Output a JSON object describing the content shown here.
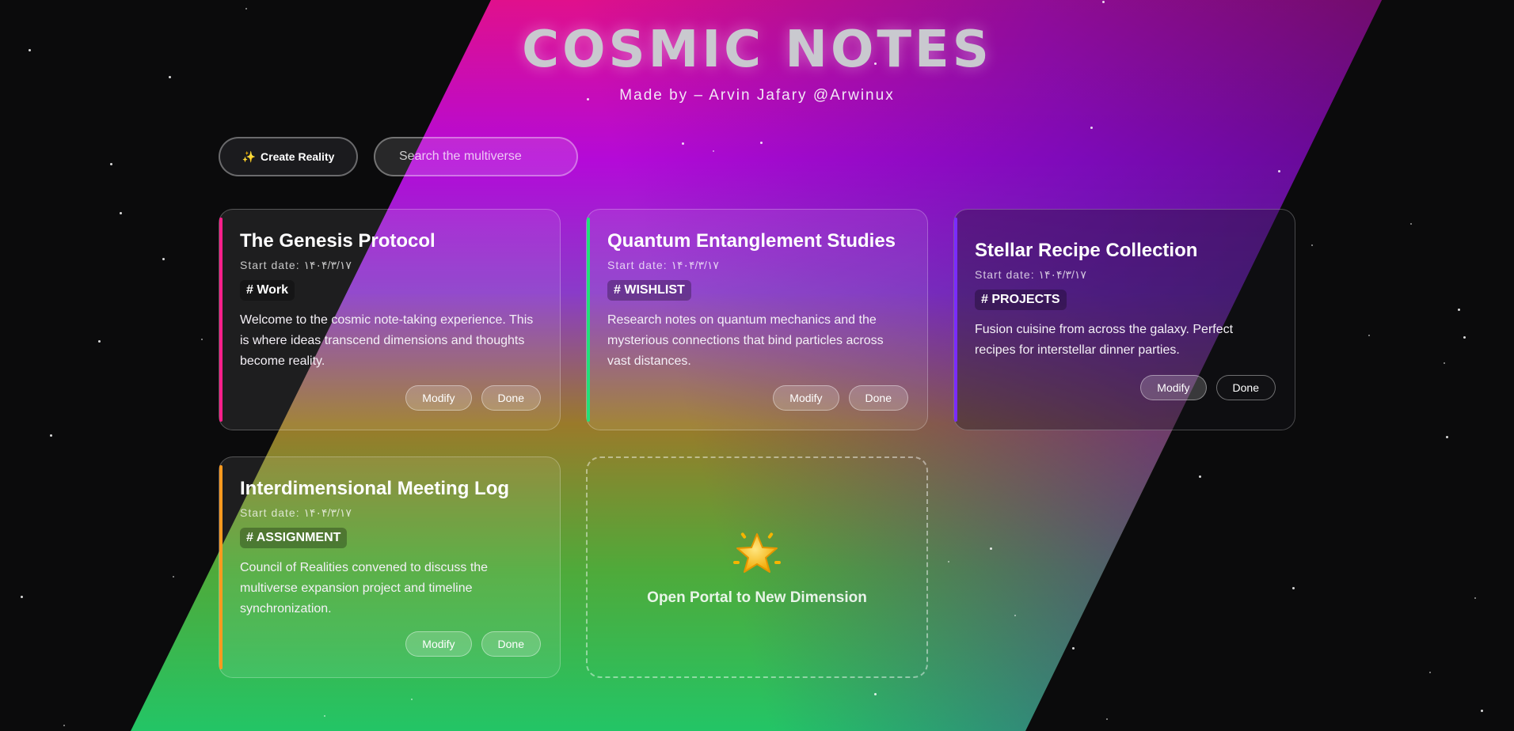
{
  "app": {
    "title": "COSMIC NOTES",
    "subtitle": "Made by – Arvin Jafary @Arwinux"
  },
  "toolbar": {
    "create_label": "Create Reality",
    "create_icon": "sparkles-icon",
    "search_placeholder": "Search the multiverse"
  },
  "notes": [
    {
      "title": "The Genesis Protocol",
      "date": "Start date: ۱۴۰۴/۳/۱۷",
      "tag": "# Work",
      "body": "Welcome to the cosmic note-taking experience. This is where ideas transcend dimensions and thoughts become reality.",
      "accent": "#ff1f8a",
      "modify": "Modify",
      "done": "Done"
    },
    {
      "title": "Quantum Entanglement Studies",
      "date": "Start date: ۱۴۰۴/۳/۱۷",
      "tag": "# WISHLIST",
      "body": "Research notes on quantum mechanics and the mysterious connections that bind particles across vast distances.",
      "accent": "#22e07a",
      "modify": "Modify",
      "done": "Done"
    },
    {
      "title": "Stellar Recipe Collection",
      "date": "Start date: ۱۴۰۴/۳/۱۷",
      "tag": "# PROJECTS",
      "body": "Fusion cuisine from across the galaxy. Perfect recipes for interstellar dinner parties.",
      "accent": "#7a2bff",
      "modify": "Modify",
      "done": "Done"
    },
    {
      "title": "Interdimensional Meeting Log",
      "date": "Start date: ۱۴۰۴/۳/۱۷",
      "tag": "# ASSIGNMENT",
      "body": "Council of Realities convened to discuss the multiverse expansion project and timeline synchronization.",
      "accent": "#ff9a1f",
      "modify": "Modify",
      "done": "Done"
    }
  ],
  "portal": {
    "label": "Open Portal to New Dimension",
    "icon": "star-icon"
  }
}
